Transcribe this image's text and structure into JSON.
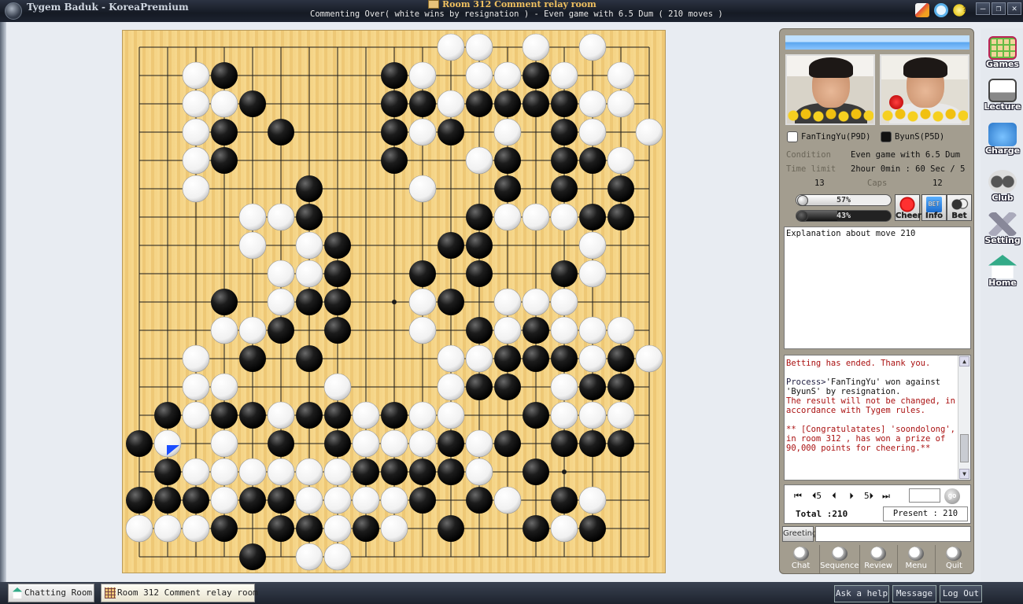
{
  "window": {
    "app_title": "Tygem Baduk - KoreaPremium",
    "room_title": "Room 312 Comment relay room",
    "status": "Commenting Over( white wins by resignation ) - Even game with 6.5 Dum  ( 210 moves )"
  },
  "board": {
    "size": 19,
    "star_points": [
      [
        3,
        3
      ],
      [
        3,
        9
      ],
      [
        3,
        15
      ],
      [
        9,
        3
      ],
      [
        9,
        9
      ],
      [
        9,
        15
      ],
      [
        15,
        3
      ],
      [
        15,
        9
      ],
      [
        15,
        15
      ]
    ],
    "last_move": [
      1,
      14
    ],
    "colors": {
      "board": "#f3cf7c",
      "line": "#1a1a1a",
      "black": "#111111",
      "white": "#ffffff",
      "last_move_marker": "#1a4dff"
    },
    "black_stones": [
      [
        3,
        1
      ],
      [
        9,
        1
      ],
      [
        14,
        1
      ],
      [
        4,
        2
      ],
      [
        9,
        2
      ],
      [
        10,
        2
      ],
      [
        12,
        2
      ],
      [
        13,
        2
      ],
      [
        14,
        2
      ],
      [
        15,
        2
      ],
      [
        3,
        3
      ],
      [
        5,
        3
      ],
      [
        9,
        3
      ],
      [
        11,
        3
      ],
      [
        15,
        3
      ],
      [
        3,
        4
      ],
      [
        9,
        4
      ],
      [
        13,
        4
      ],
      [
        15,
        4
      ],
      [
        16,
        4
      ],
      [
        6,
        5
      ],
      [
        13,
        5
      ],
      [
        15,
        5
      ],
      [
        17,
        5
      ],
      [
        6,
        6
      ],
      [
        12,
        6
      ],
      [
        16,
        6
      ],
      [
        17,
        6
      ],
      [
        7,
        7
      ],
      [
        11,
        7
      ],
      [
        12,
        7
      ],
      [
        7,
        8
      ],
      [
        10,
        8
      ],
      [
        12,
        8
      ],
      [
        15,
        8
      ],
      [
        3,
        9
      ],
      [
        6,
        9
      ],
      [
        7,
        9
      ],
      [
        11,
        9
      ],
      [
        5,
        10
      ],
      [
        7,
        10
      ],
      [
        12,
        10
      ],
      [
        14,
        10
      ],
      [
        4,
        11
      ],
      [
        6,
        11
      ],
      [
        13,
        11
      ],
      [
        14,
        11
      ],
      [
        15,
        11
      ],
      [
        16,
        11
      ],
      [
        17,
        11
      ],
      [
        12,
        12
      ],
      [
        13,
        12
      ],
      [
        16,
        12
      ],
      [
        17,
        12
      ],
      [
        1,
        13
      ],
      [
        3,
        13
      ],
      [
        4,
        13
      ],
      [
        6,
        13
      ],
      [
        7,
        13
      ],
      [
        9,
        13
      ],
      [
        14,
        13
      ],
      [
        0,
        14
      ],
      [
        5,
        14
      ],
      [
        7,
        14
      ],
      [
        11,
        14
      ],
      [
        13,
        14
      ],
      [
        15,
        14
      ],
      [
        16,
        14
      ],
      [
        17,
        14
      ],
      [
        1,
        15
      ],
      [
        8,
        15
      ],
      [
        9,
        15
      ],
      [
        10,
        15
      ],
      [
        11,
        15
      ],
      [
        14,
        15
      ],
      [
        0,
        16
      ],
      [
        1,
        16
      ],
      [
        2,
        16
      ],
      [
        4,
        16
      ],
      [
        5,
        16
      ],
      [
        10,
        16
      ],
      [
        12,
        16
      ],
      [
        15,
        16
      ],
      [
        3,
        17
      ],
      [
        5,
        17
      ],
      [
        6,
        17
      ],
      [
        8,
        17
      ],
      [
        11,
        17
      ],
      [
        14,
        17
      ],
      [
        16,
        17
      ],
      [
        4,
        18
      ]
    ],
    "white_stones": [
      [
        11,
        0
      ],
      [
        12,
        0
      ],
      [
        14,
        0
      ],
      [
        16,
        0
      ],
      [
        2,
        1
      ],
      [
        10,
        1
      ],
      [
        12,
        1
      ],
      [
        13,
        1
      ],
      [
        15,
        1
      ],
      [
        17,
        1
      ],
      [
        2,
        2
      ],
      [
        3,
        2
      ],
      [
        11,
        2
      ],
      [
        16,
        2
      ],
      [
        17,
        2
      ],
      [
        2,
        3
      ],
      [
        10,
        3
      ],
      [
        13,
        3
      ],
      [
        16,
        3
      ],
      [
        18,
        3
      ],
      [
        2,
        4
      ],
      [
        12,
        4
      ],
      [
        17,
        4
      ],
      [
        2,
        5
      ],
      [
        10,
        5
      ],
      [
        4,
        6
      ],
      [
        5,
        6
      ],
      [
        13,
        6
      ],
      [
        14,
        6
      ],
      [
        15,
        6
      ],
      [
        4,
        7
      ],
      [
        6,
        7
      ],
      [
        16,
        7
      ],
      [
        5,
        8
      ],
      [
        6,
        8
      ],
      [
        16,
        8
      ],
      [
        5,
        9
      ],
      [
        10,
        9
      ],
      [
        13,
        9
      ],
      [
        14,
        9
      ],
      [
        15,
        9
      ],
      [
        3,
        10
      ],
      [
        4,
        10
      ],
      [
        10,
        10
      ],
      [
        13,
        10
      ],
      [
        15,
        10
      ],
      [
        16,
        10
      ],
      [
        17,
        10
      ],
      [
        2,
        11
      ],
      [
        11,
        11
      ],
      [
        12,
        11
      ],
      [
        16,
        11
      ],
      [
        18,
        11
      ],
      [
        2,
        12
      ],
      [
        3,
        12
      ],
      [
        7,
        12
      ],
      [
        11,
        12
      ],
      [
        15,
        12
      ],
      [
        2,
        13
      ],
      [
        5,
        13
      ],
      [
        8,
        13
      ],
      [
        10,
        13
      ],
      [
        11,
        13
      ],
      [
        15,
        13
      ],
      [
        16,
        13
      ],
      [
        17,
        13
      ],
      [
        1,
        14
      ],
      [
        3,
        14
      ],
      [
        8,
        14
      ],
      [
        9,
        14
      ],
      [
        10,
        14
      ],
      [
        12,
        14
      ],
      [
        2,
        15
      ],
      [
        3,
        15
      ],
      [
        4,
        15
      ],
      [
        5,
        15
      ],
      [
        6,
        15
      ],
      [
        7,
        15
      ],
      [
        12,
        15
      ],
      [
        3,
        16
      ],
      [
        6,
        16
      ],
      [
        7,
        16
      ],
      [
        8,
        16
      ],
      [
        9,
        16
      ],
      [
        13,
        16
      ],
      [
        16,
        16
      ],
      [
        0,
        17
      ],
      [
        1,
        17
      ],
      [
        2,
        17
      ],
      [
        7,
        17
      ],
      [
        9,
        17
      ],
      [
        15,
        17
      ],
      [
        6,
        18
      ],
      [
        7,
        18
      ]
    ]
  },
  "players": {
    "white": {
      "name": "FanTingYu(P9D)",
      "captures": "13",
      "cheer_percent": "57%",
      "cheer_value": 0.57
    },
    "black": {
      "name": "ByunS(P5D)",
      "captures": "12",
      "cheer_percent": "43%",
      "cheer_value": 0.43
    }
  },
  "info": {
    "condition_label": "Condition",
    "condition_value": "Even game with 6.5 Dum",
    "timelimit_label": "Time limit",
    "timelimit_value": "2hour 0min : 60 Sec / 5",
    "caps_label": "Caps"
  },
  "buttons": {
    "cheer": "Cheer",
    "info": "Info",
    "info_badge": "BET",
    "bet": "Bet",
    "go": "go"
  },
  "explanation": "Explanation about move 210",
  "chat": {
    "line1": "Betting has ended. Thank you.",
    "line2_prefix": "Process>",
    "line2_rest": "'FanTingYu' won against 'ByunS' by resignation.",
    "line3": "The result will not be changed, in accordance with Tygem rules.",
    "line4": "** [Congratulatates] 'soondolong', in room 312 , has won a prize of 90,000 points for cheering.**"
  },
  "navigation": {
    "first": "⏮",
    "back5": "⏴5",
    "prev": "⏴",
    "next": "⏵",
    "fwd5": "5⏵",
    "last": "⏭",
    "total_label": "Total :210",
    "present_label": "Present : 210"
  },
  "greeting_label": "Greeting",
  "toolbar": {
    "chat": "Chat",
    "sequence": "Sequence",
    "review": "Review",
    "menu": "Menu",
    "quit": "Quit"
  },
  "sidebar": {
    "games": "Games",
    "lecture": "Lecture",
    "charge": "Charge",
    "club": "Club",
    "setting": "Setting",
    "home": "Home"
  },
  "taskbar": {
    "chatting_tab": "Chatting Room",
    "room_tab": "Room 312 Comment relay room",
    "ask_help": "Ask a help",
    "message": "Message",
    "logout": "Log Out"
  }
}
